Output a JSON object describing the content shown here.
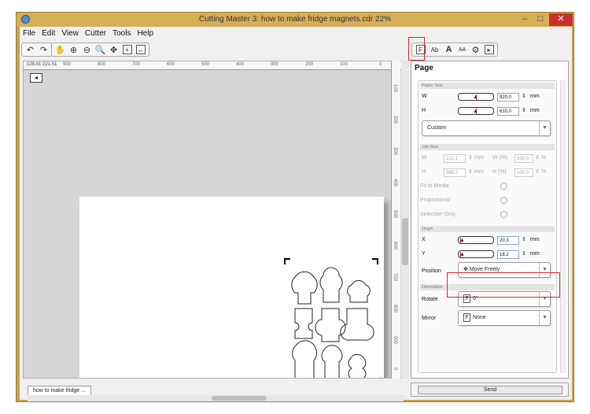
{
  "window": {
    "title": "Cutting Master 3: how to make fridge magnets.cdr 22%",
    "minimize": "–",
    "maximize": "□",
    "close": "✕"
  },
  "menu": [
    "File",
    "Edit",
    "View",
    "Cutter",
    "Tools",
    "Help"
  ],
  "ruler": {
    "coord": "128.41  221.51",
    "top_ticks": [
      "900",
      "800",
      "700",
      "600",
      "500",
      "400",
      "300",
      "200",
      "100",
      "0"
    ],
    "right_ticks": [
      "100",
      "200",
      "300",
      "400",
      "500",
      "600",
      "700",
      "800",
      "900",
      "0"
    ]
  },
  "panel_tabs": [
    "Ab",
    "A",
    "AA"
  ],
  "document_tab": "how to make fridge ...",
  "panel": {
    "title": "Page",
    "paper_size": {
      "heading": "Paper Size",
      "w_label": "W",
      "w_value": "920,0",
      "w_unit": "mm",
      "h_label": "H",
      "h_value": "610,0",
      "h_unit": "mm",
      "preset": "Custom"
    },
    "job_size": {
      "heading": "Job Size",
      "w_label": "W",
      "w_value": "212,1",
      "w_unit": "mm",
      "w_pct_label": "W (%)",
      "w_pct_value": "100,0",
      "w_pct_unit": "%",
      "h_label": "H",
      "h_value": "386,2",
      "h_unit": "mm",
      "h_pct_label": "H (%)",
      "h_pct_value": "100,0",
      "h_pct_unit": "%",
      "fit_to_media": "Fit to Media",
      "proportional": "Proportional",
      "selection_only": "Selection Only"
    },
    "origin": {
      "heading": "Origin",
      "x_label": "X",
      "x_value": "20,3",
      "x_unit": "mm",
      "y_label": "Y",
      "y_value": "18,2",
      "y_unit": "mm",
      "position_label": "Position",
      "position_value": "Move Freely"
    },
    "orientation": {
      "heading": "Orientation",
      "rotate_label": "Rotate",
      "rotate_value": "0°",
      "mirror_label": "Mirror",
      "mirror_value": "None"
    }
  },
  "send_label": "Send",
  "colors": {
    "titlebar": "#d6ae56",
    "close": "#c9302c",
    "highlight": "#d9262b",
    "origin_x_arrow": "#2233cc",
    "origin_y_arrow": "#d9262b"
  }
}
